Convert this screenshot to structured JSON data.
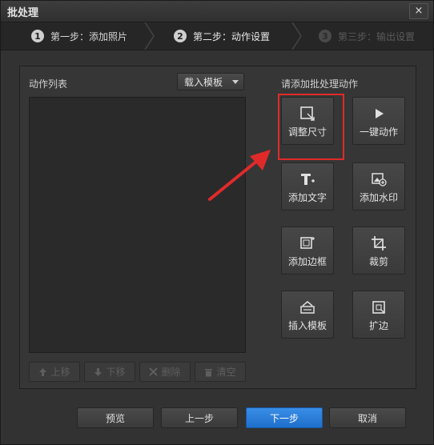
{
  "window": {
    "title": "批处理",
    "close": "×"
  },
  "steps": [
    {
      "num": "1",
      "label": "第一步：添加照片"
    },
    {
      "num": "2",
      "label": "第二步：动作设置"
    },
    {
      "num": "3",
      "label": "第三步：输出设置"
    }
  ],
  "left": {
    "title": "动作列表",
    "template_dropdown": "载入模板",
    "buttons": {
      "up": "上移",
      "down": "下移",
      "delete": "删除",
      "clear": "清空"
    }
  },
  "right": {
    "title": "请添加批处理动作",
    "actions": {
      "resize": "调整尺寸",
      "one_click": "一键动作",
      "add_text": "添加文字",
      "add_watermark": "添加水印",
      "add_border": "添加边框",
      "crop": "裁剪",
      "insert_template": "插入模板",
      "expand": "扩边"
    }
  },
  "footer": {
    "preview": "预览",
    "prev": "上一步",
    "next": "下一步",
    "cancel": "取消"
  },
  "colors": {
    "primary": "#2a7fd9",
    "highlight": "#e02a2a"
  }
}
